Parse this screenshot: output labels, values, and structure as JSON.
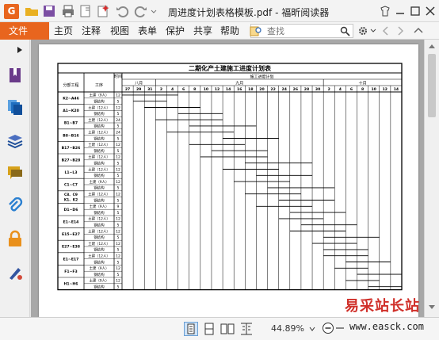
{
  "window": {
    "title": "周进度计划表格模板.pdf - 福昕阅读器",
    "logo_letter": "G"
  },
  "menu": {
    "file": "文件",
    "items": [
      "主页",
      "注释",
      "视图",
      "表单",
      "保护",
      "共享",
      "帮助"
    ]
  },
  "search": {
    "placeholder": "查找"
  },
  "statusbar": {
    "zoom": "44.89%"
  },
  "watermark": {
    "title": "易采站长站",
    "url": "www.easck.com"
  },
  "colors": {
    "accent": "#e8651e",
    "sidebar_icons": [
      "#6a3b8a",
      "#1f6fc0",
      "#1f4f9a",
      "#d7a21b",
      "#2a7fd0",
      "#e9901c",
      "#3355a0"
    ]
  },
  "document": {
    "title": "二期化产土建施工进度计划表",
    "col_section": "分部工程",
    "col_process": "工序",
    "col_time": "时间",
    "plan_header": "施工进度计划",
    "months": [
      "八月",
      "九月",
      "十月"
    ],
    "days": [
      "27",
      "29",
      "31",
      "2",
      "4",
      "6",
      "8",
      "10",
      "12",
      "14",
      "16",
      "18",
      "20",
      "22",
      "24",
      "26",
      "28",
      "30",
      "2",
      "4",
      "6",
      "8",
      "10",
      "12",
      "14"
    ],
    "sections": [
      "K2~A46",
      "A1~K20",
      "B1~B7",
      "B8~B16",
      "B17~B26",
      "B27~B28",
      "L1~L3",
      "C1~C7",
      "C8、C9、K1、K2",
      "D1~D6",
      "E1~E14",
      "E15~E27",
      "E27~E38",
      "E1~E17",
      "F1~F3",
      "H1~H6"
    ],
    "processes": [
      "土建（9人）",
      "钢结构",
      "土建（12人）",
      "钢结构",
      "土建（12人）",
      "钢结构",
      "土建（12人）",
      "钢结构",
      "土建（12人）",
      "钢结构",
      "土建（12人）",
      "钢结构",
      "土建（12人）",
      "钢结构",
      "土建（9人）",
      "钢结构",
      "土建（12人）",
      "钢结构",
      "土建（9人）",
      "钢结构",
      "土建（12人）",
      "钢结构",
      "土建（12人）",
      "钢结构",
      "土建（12人）",
      "钢结构",
      "土建（12人）",
      "钢结构",
      "土建（9人）",
      "钢结构",
      "土建（9人）",
      "钢结构"
    ],
    "durations": [
      "12",
      "5",
      "12",
      "5",
      "24",
      "5",
      "24",
      "5",
      "12",
      "5",
      "12",
      "5",
      "12",
      "5",
      "12",
      "5",
      "12",
      "5",
      "9",
      "5",
      "12",
      "5",
      "12",
      "5",
      "12",
      "5",
      "12",
      "5",
      "12",
      "5",
      "12",
      "5"
    ]
  }
}
